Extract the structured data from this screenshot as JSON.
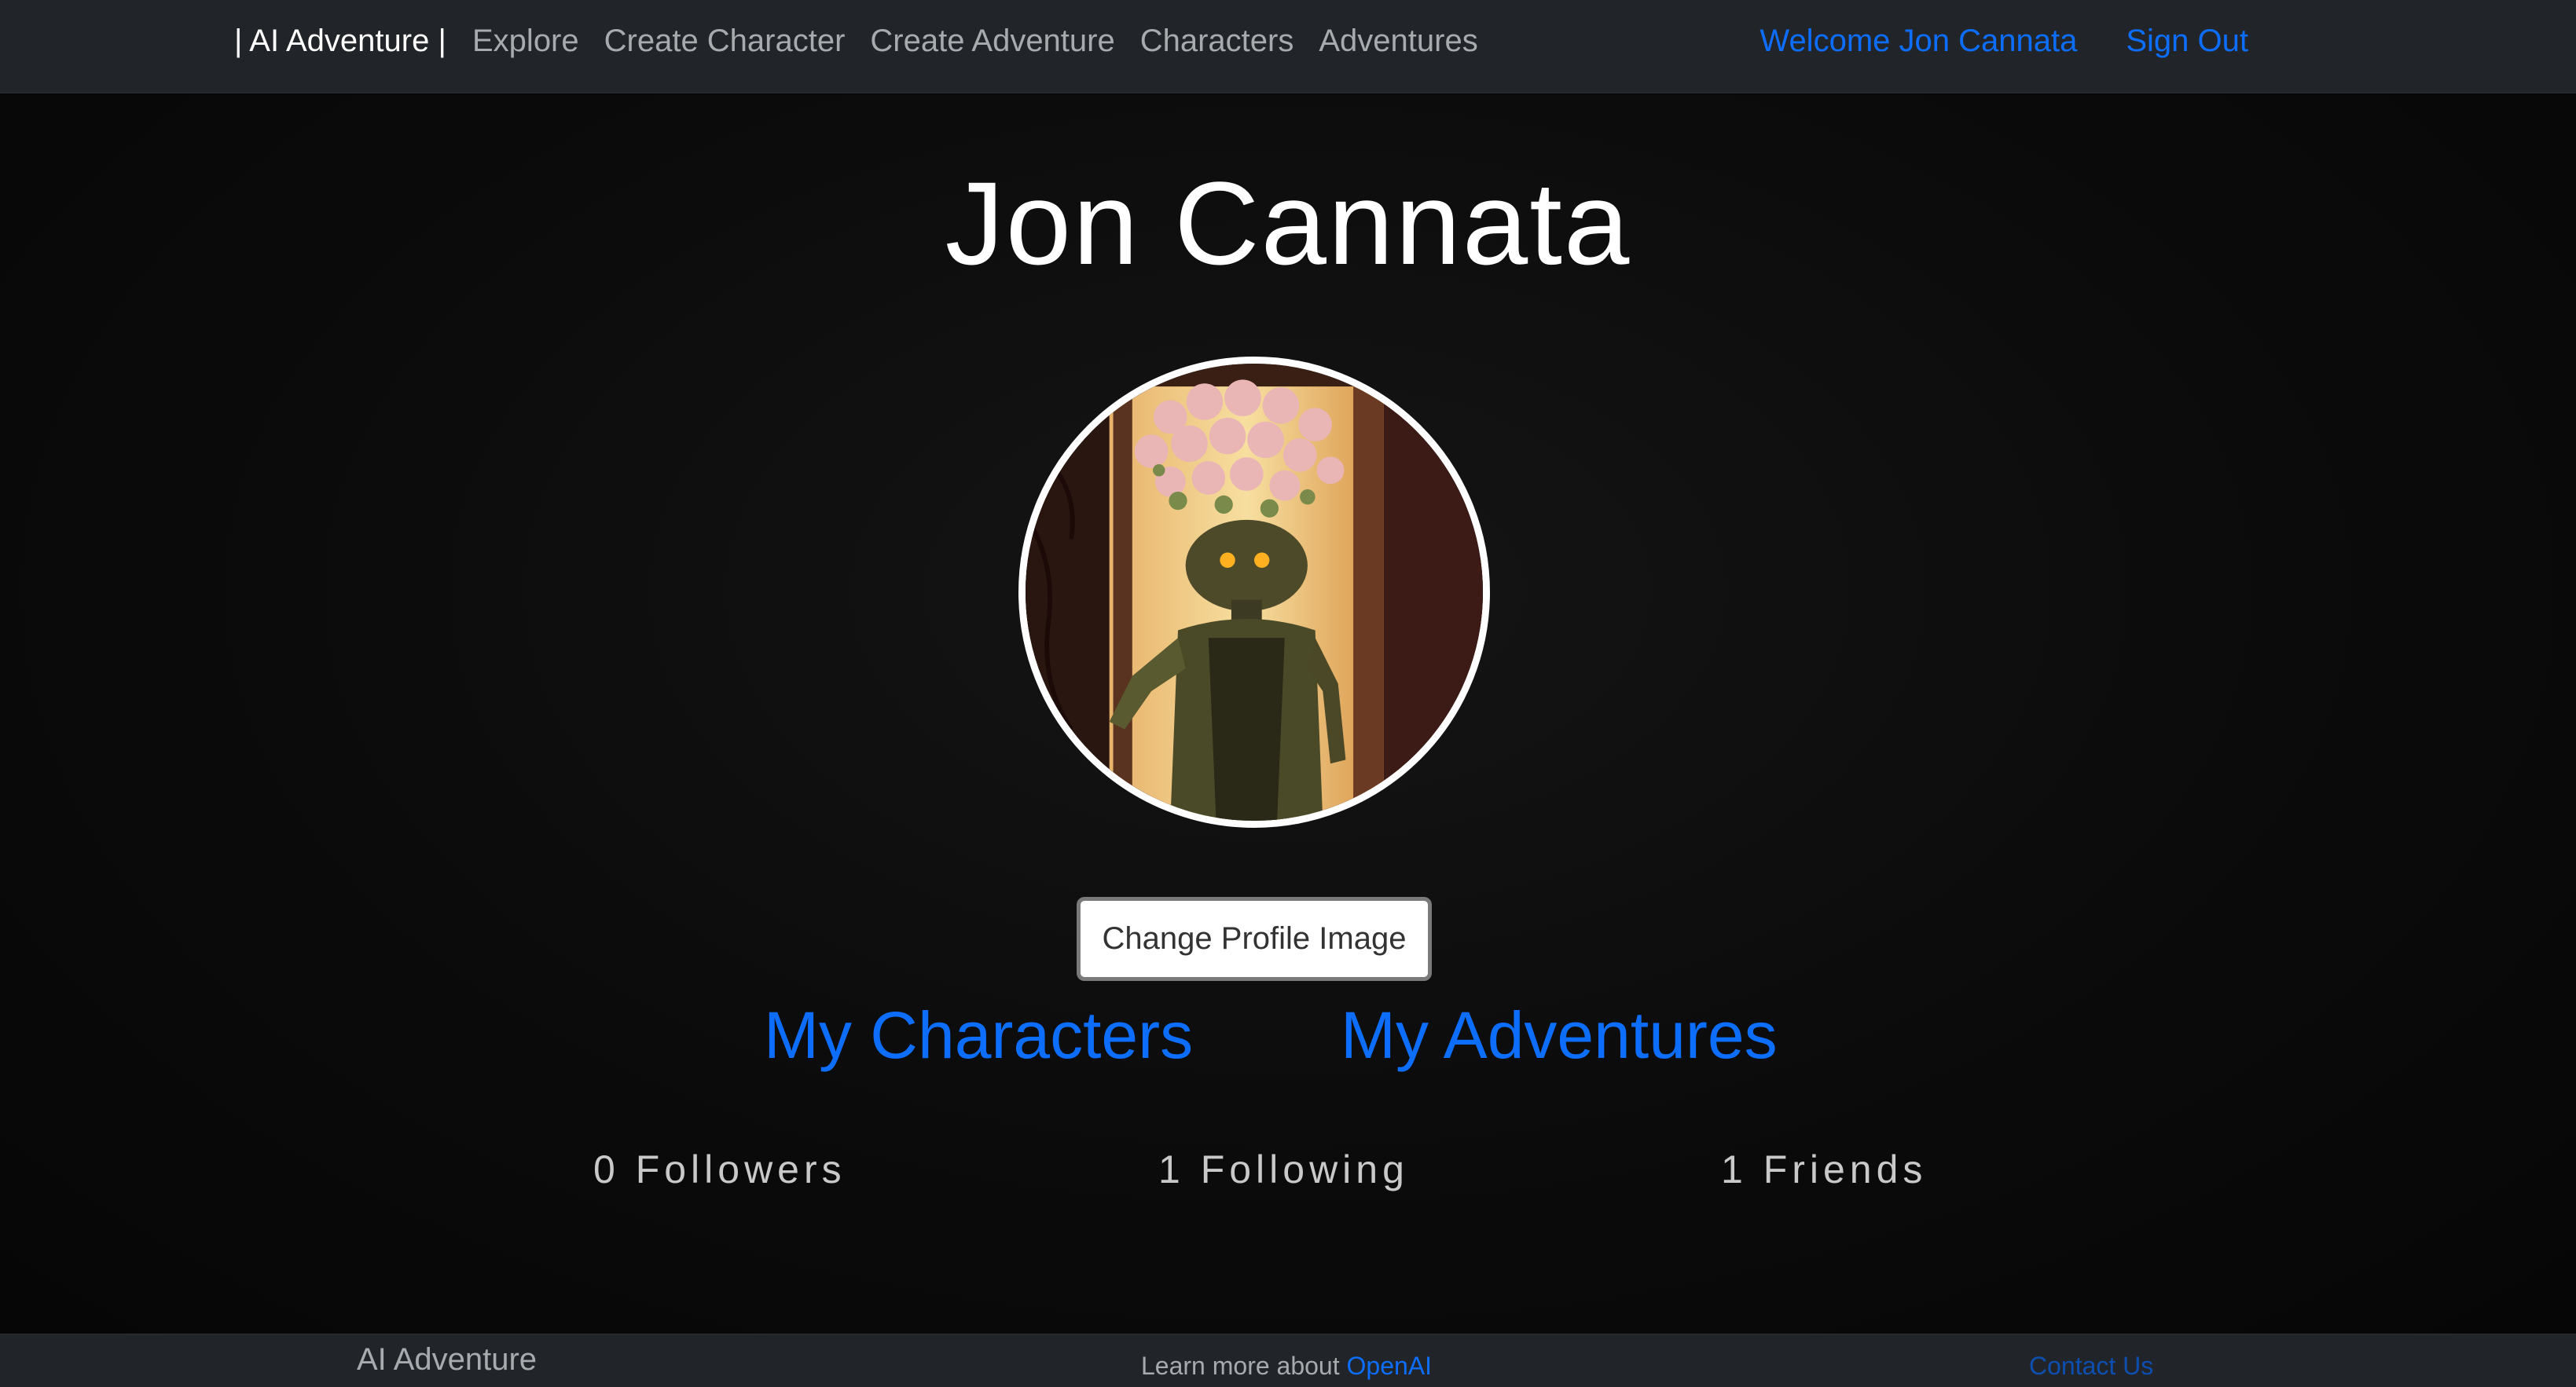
{
  "navbar": {
    "brand": "| AI Adventure |",
    "links": [
      "Explore",
      "Create Character",
      "Create Adventure",
      "Characters",
      "Adventures"
    ],
    "welcome": "Welcome Jon Cannata",
    "sign_out": "Sign Out"
  },
  "profile": {
    "name": "Jon Cannata",
    "change_image_label": "Change Profile Image",
    "my_characters": "My Characters",
    "my_adventures": "My Adventures",
    "followers": "0 Followers",
    "following": "1 Following",
    "friends": "1 Friends"
  },
  "footer": {
    "brand": "AI Adventure",
    "learn_more": "Learn more about ",
    "openai_link": "OpenAI",
    "contact": "Contact Us"
  },
  "colors": {
    "navbar_bg": "#212529",
    "link_blue": "#0d6efd",
    "nav_text": "#a8abae"
  }
}
